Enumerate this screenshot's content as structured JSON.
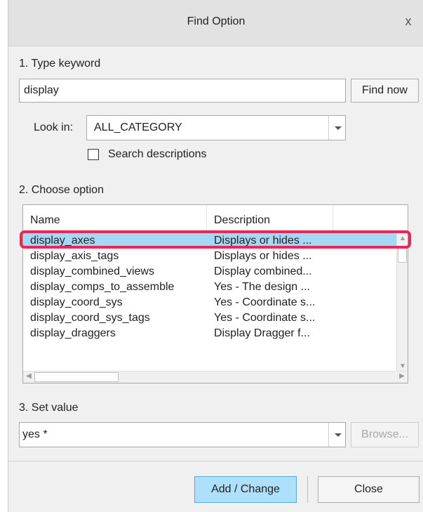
{
  "window": {
    "title": "Find Option",
    "close_glyph": "x"
  },
  "step1": {
    "label": "1. Type keyword",
    "keyword_value": "display",
    "find_button": "Find now"
  },
  "look_in": {
    "label": "Look in:",
    "value": "ALL_CATEGORY"
  },
  "search_descriptions": {
    "label": "Search descriptions",
    "checked": false
  },
  "step2": {
    "label": "2. Choose option"
  },
  "options_table": {
    "columns": [
      "Name",
      "Description"
    ],
    "rows": [
      {
        "name": "display_axes",
        "description": "Displays or hides ..."
      },
      {
        "name": "display_axis_tags",
        "description": "Displays or hides ..."
      },
      {
        "name": "display_combined_views",
        "description": "Display combined..."
      },
      {
        "name": "display_comps_to_assemble",
        "description": "Yes - The design ..."
      },
      {
        "name": "display_coord_sys",
        "description": "Yes - Coordinate s..."
      },
      {
        "name": "display_coord_sys_tags",
        "description": "Yes - Coordinate s..."
      },
      {
        "name": "display_draggers",
        "description": "Display Dragger f..."
      }
    ],
    "selected_index": 0
  },
  "step3": {
    "label": "3. Set value",
    "value": "yes *",
    "browse_button": "Browse..."
  },
  "footer": {
    "add_change_button": "Add / Change",
    "close_button": "Close"
  },
  "colors": {
    "selection": "#a6d7f3",
    "highlight_outline": "#e8285a",
    "primary_button": "#aee0fb"
  }
}
